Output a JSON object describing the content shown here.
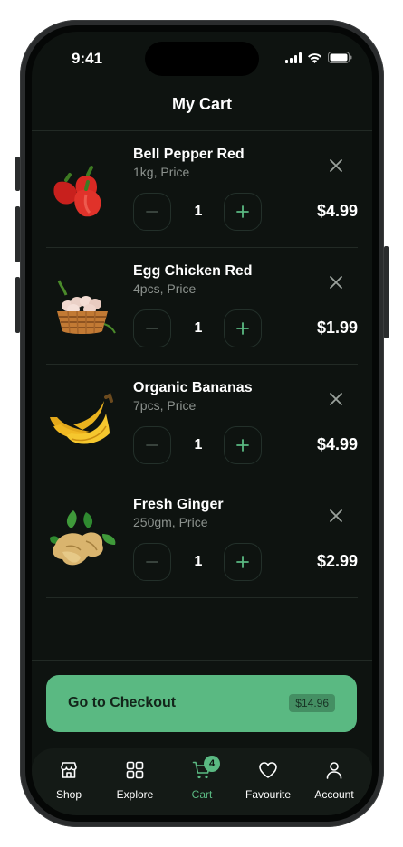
{
  "status_bar": {
    "time": "9:41"
  },
  "header": {
    "title": "My Cart"
  },
  "cart": {
    "items": [
      {
        "name": "Bell Pepper Red",
        "subtitle": "1kg, Price",
        "quantity": "1",
        "price": "$4.99",
        "image": "bell-pepper"
      },
      {
        "name": "Egg Chicken Red",
        "subtitle": "4pcs, Price",
        "quantity": "1",
        "price": "$1.99",
        "image": "egg-basket"
      },
      {
        "name": "Organic Bananas",
        "subtitle": "7pcs, Price",
        "quantity": "1",
        "price": "$4.99",
        "image": "bananas"
      },
      {
        "name": "Fresh Ginger",
        "subtitle": "250gm, Price",
        "quantity": "1",
        "price": "$2.99",
        "image": "ginger"
      }
    ]
  },
  "checkout": {
    "label": "Go to Checkout",
    "total": "$14.96"
  },
  "tabbar": {
    "tabs": [
      {
        "label": "Shop",
        "icon": "store-icon"
      },
      {
        "label": "Explore",
        "icon": "grid-icon"
      },
      {
        "label": "Cart",
        "icon": "cart-icon",
        "badge": "4",
        "active": true
      },
      {
        "label": "Favourite",
        "icon": "heart-icon"
      },
      {
        "label": "Account",
        "icon": "user-icon"
      }
    ]
  },
  "colors": {
    "accent": "#5ab982",
    "background": "#0e1310",
    "text": "#ffffff",
    "muted": "#8b918d"
  }
}
